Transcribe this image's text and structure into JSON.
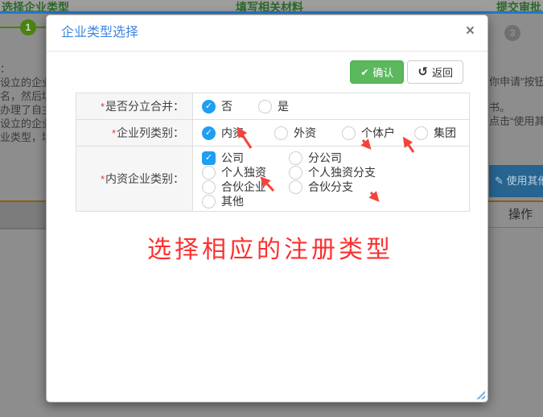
{
  "backdrop": {
    "steps": [
      {
        "label": "选择企业类型"
      },
      {
        "label": "填写相关材料"
      },
      {
        "label": "提交审批"
      }
    ],
    "step_badge_current": "1",
    "step_badge_last": "3",
    "left_text_lines": {
      "l0": "：",
      "l1": "设立的企业类",
      "l2": "名，然后填写",
      "l3": "办理了自主核",
      "l4": "设立的企业类",
      "l5": "业类型，填写"
    },
    "right_text_lines": {
      "l0": "你申请”按钮",
      "l1": "书。",
      "l2": "点击“使用其他"
    },
    "use_other_button_label": "使用其他",
    "ops_column_header": "操作"
  },
  "modal": {
    "title": "企业类型选择",
    "close_glyph": "×",
    "confirm_label": "确认",
    "back_label": "返回",
    "required_mark": "*",
    "rows": {
      "r1": {
        "label": "是否分立合并："
      },
      "r2": {
        "label": "企业列类别："
      },
      "r3": {
        "label": "内资企业类别："
      }
    },
    "row1_options": [
      {
        "text": "否",
        "checked": true
      },
      {
        "text": "是",
        "checked": false
      }
    ],
    "row2_options": [
      {
        "text": "内资",
        "checked": true
      },
      {
        "text": "外资",
        "checked": false
      },
      {
        "text": "个体户",
        "checked": false
      },
      {
        "text": "集团",
        "checked": false
      }
    ],
    "row3_options": [
      {
        "text": "公司",
        "checked": true,
        "control": "checkbox"
      },
      {
        "text": "分公司",
        "checked": false
      },
      {
        "text": "个人独资",
        "checked": false
      },
      {
        "text": "个人独资分支",
        "checked": false
      },
      {
        "text": "合伙企业",
        "checked": false
      },
      {
        "text": "合伙分支",
        "checked": false
      },
      {
        "text": "其他",
        "checked": false
      }
    ],
    "annotation_text": "选择相应的注册类型"
  },
  "icons": {
    "confirm_check": "✔",
    "back_undo": "↺",
    "option_tick": "✓",
    "edit_pencil": "✎"
  },
  "colors": {
    "radio_checked_blue": "#1e9ff2",
    "confirm_green": "#5cb85c",
    "title_blue": "#3e86de",
    "annotation_red": "#fd2f2f",
    "arrow_red": "#f4443a",
    "step_green": "#4a830f",
    "top_blue_line": "#1d79cf"
  }
}
